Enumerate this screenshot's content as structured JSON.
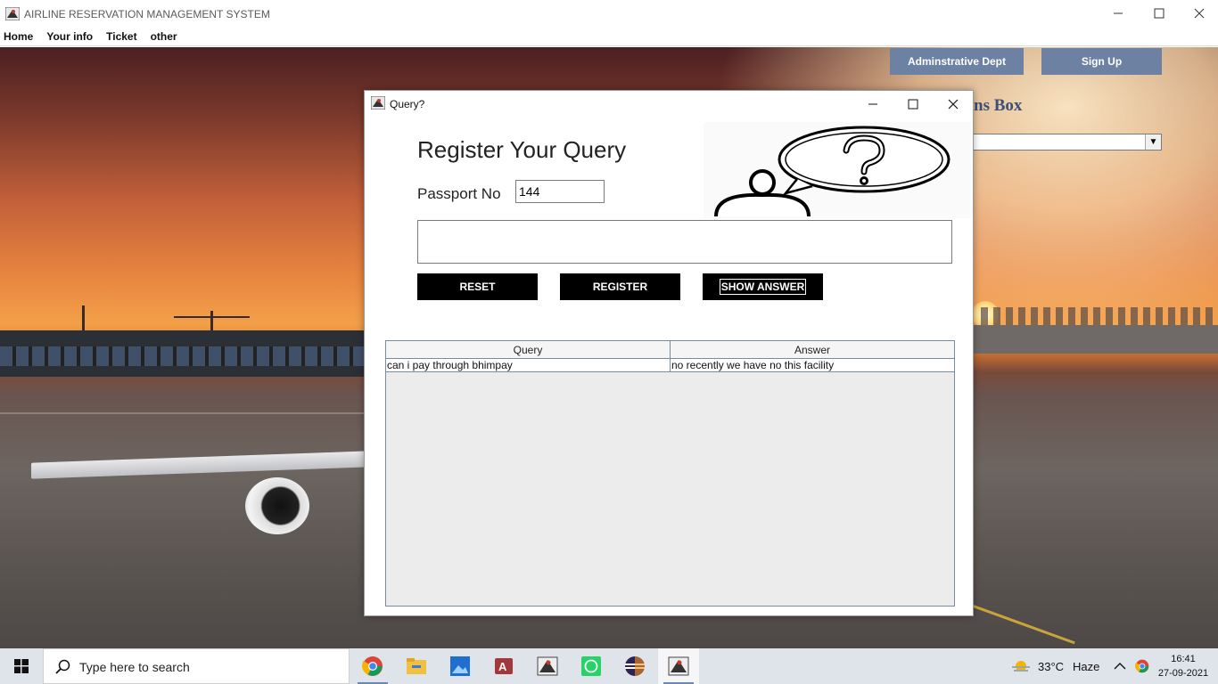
{
  "main_window": {
    "title": "AIRLINE RESERVATION MANAGEMENT SYSTEM",
    "menu": [
      "Home",
      "Your info",
      "Ticket",
      "other"
    ]
  },
  "background_app": {
    "admin_button": "Adminstrative Dept",
    "signup_button": "Sign Up",
    "heading_fragment": "ns Box"
  },
  "dialog": {
    "title": "Query?",
    "heading": "Register Your Query",
    "passport_label": "Passport No",
    "passport_value": "144",
    "query_text": "",
    "buttons": {
      "reset": "RESET",
      "register": "REGISTER",
      "show_answer": "SHOW ANSWER"
    },
    "table": {
      "columns": [
        "Query",
        "Answer"
      ],
      "rows": [
        [
          "can i pay through bhimpay",
          "no recently we have no this facility"
        ]
      ]
    }
  },
  "taskbar": {
    "search_placeholder": "Type here to search",
    "apps": [
      "chrome-icon",
      "file-explorer-icon",
      "photos-icon",
      "access-icon",
      "java-app-icon",
      "whatsapp-icon",
      "eclipse-icon",
      "java-app-icon"
    ],
    "weather": {
      "temp": "33°C",
      "condition": "Haze"
    },
    "clock": {
      "time": "16:41",
      "date": "27-09-2021"
    }
  },
  "colors": {
    "button_bg": "#000000",
    "bg_button": "#6d81a3",
    "table_border": "#7a8aa0"
  }
}
